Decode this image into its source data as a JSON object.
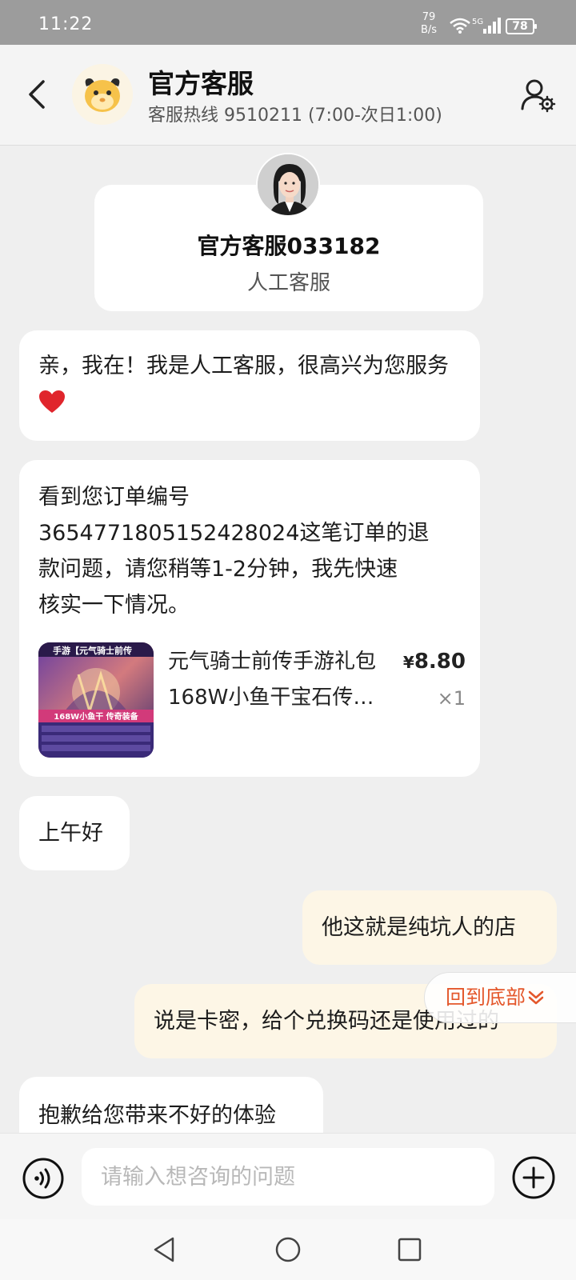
{
  "status_bar": {
    "time": "11:22",
    "net_speed_value": "79",
    "net_speed_unit": "B/s",
    "cell_label": "5G",
    "battery": "78",
    "icons": [
      "wifi-icon",
      "signal-icon",
      "battery-icon"
    ]
  },
  "header": {
    "title": "官方客服",
    "subtitle": "客服热线 9510211 (7:00-次日1:00)",
    "icons": [
      "back-arrow-icon",
      "mascot-avatar",
      "user-settings-icon"
    ]
  },
  "agent_card": {
    "name": "官方客服033182",
    "role": "人工客服"
  },
  "messages": [
    {
      "from": "agent",
      "text": "亲，我在！我是人工客服，很高兴为您服务"
    },
    {
      "from": "agent",
      "text_lines": [
        "看到您订单编号",
        "3654771805152428024这笔订单的退",
        "款问题，请您稍等1-2分钟，我先快速",
        "核实一下情况。"
      ],
      "product": {
        "name_line1": "元气骑士前传手游礼包",
        "name_line2": "168W小鱼干宝石传…",
        "price_symbol": "¥",
        "price": "8.80",
        "quantity": "×1",
        "thumb_banner": "手游【元气骑士前传",
        "thumb_tag": "168W小鱼干 传奇装备"
      }
    },
    {
      "from": "agent",
      "text": "上午好"
    },
    {
      "from": "user",
      "text": "他这就是纯坑人的店"
    },
    {
      "from": "user",
      "text": "说是卡密，给个兑换码还是使用过的"
    },
    {
      "from": "agent",
      "text": "抱歉给您带来不好的体验"
    }
  ],
  "back_to_bottom": "回到底部",
  "input": {
    "placeholder": "请输入想咨询的问题"
  },
  "colors": {
    "accent": "#e4572b",
    "user_bubble": "#fdf6e6",
    "chat_background": "#efefef",
    "status_bar": "#9c9c9c"
  }
}
